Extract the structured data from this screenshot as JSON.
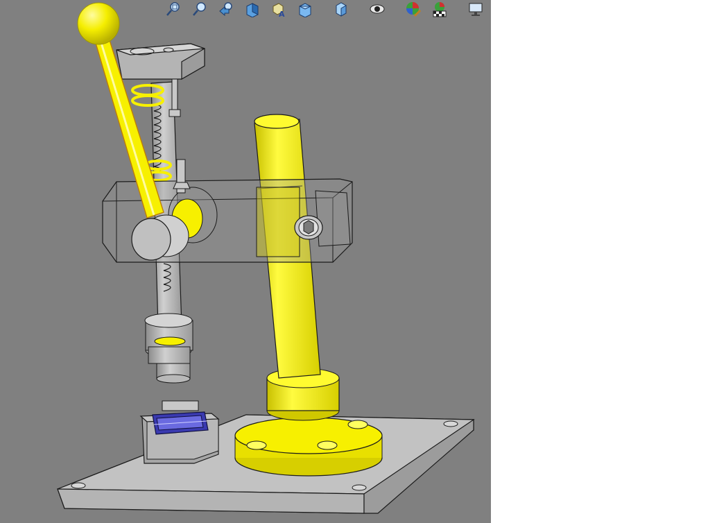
{
  "window": {
    "title": ""
  },
  "toolbar": {
    "buttons": [
      {
        "name": "zoom-to-fit-icon"
      },
      {
        "name": "zoom-to-area-icon"
      },
      {
        "name": "previous-view-icon"
      },
      {
        "name": "section-view-icon"
      },
      {
        "name": "dynamic-annotation-views-icon"
      },
      {
        "name": "view-orientation-icon"
      },
      {
        "name": "display-style-icon"
      },
      {
        "name": "hide-show-items-icon"
      },
      {
        "name": "edit-appearance-icon"
      },
      {
        "name": "apply-scene-icon"
      },
      {
        "name": "view-settings-icon"
      }
    ]
  },
  "colors": {
    "viewport_background": "#808080",
    "part_yellow": "#f7f000",
    "part_grey": "#c0c0c0",
    "transparent_housing": "#9a9a9a",
    "die_blue": "#3a3ab0",
    "edge": "#1a1a1a"
  },
  "model": {
    "parts": [
      "base-plate",
      "column-flange",
      "column",
      "housing-block",
      "lever-handle",
      "lever-knob",
      "top-bracket",
      "return-spring",
      "ram",
      "punch-holder",
      "die-block",
      "die-insert",
      "clamp-screw"
    ]
  }
}
